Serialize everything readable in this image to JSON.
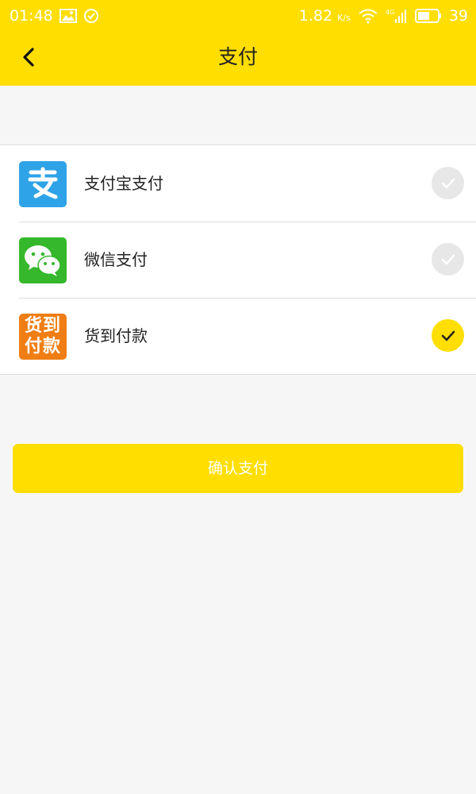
{
  "status_bar": {
    "time": "01:48",
    "speed": "1.82",
    "speed_unit": "K/s",
    "network": "4G",
    "battery": "39"
  },
  "header": {
    "title": "支付"
  },
  "payment_options": [
    {
      "label": "支付宝支付",
      "icon": "alipay-logo",
      "selected": false
    },
    {
      "label": "微信支付",
      "icon": "wechat-logo",
      "selected": false
    },
    {
      "label": "货到付款",
      "icon": "cash-on-delivery-logo",
      "logo_text": [
        "货到",
        "付款"
      ],
      "selected": true
    }
  ],
  "confirm_button": {
    "label": "确认支付"
  },
  "colors": {
    "accent": "#ffde00",
    "unselected_check": "#e7e7e7",
    "alipay": "#2fa3e7",
    "wechat": "#35b82b",
    "cod": "#f07e14"
  }
}
